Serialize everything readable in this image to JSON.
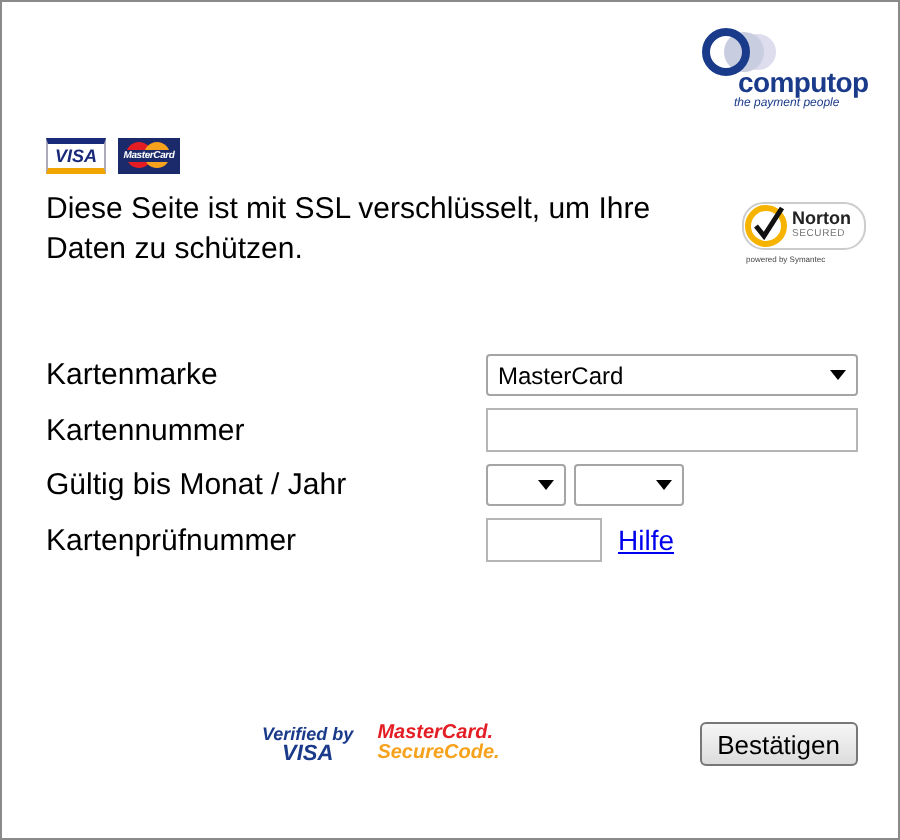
{
  "brand": {
    "name": "computop",
    "tagline": "the payment people"
  },
  "card_logos": [
    {
      "kind": "visa",
      "text": "VISA"
    },
    {
      "kind": "mastercard",
      "text": "MasterCard"
    }
  ],
  "notice": "Diese Seite ist mit SSL verschlüsselt, um Ihre Daten zu schützen.",
  "seal": {
    "name": "Norton",
    "status": "SECURED",
    "powered": "powered by Symantec"
  },
  "fields": [
    {
      "kind": "select",
      "label": "Kartenmarke",
      "value": "MasterCard"
    },
    {
      "kind": "text",
      "label": "Kartennummer"
    },
    {
      "kind": "date",
      "label": "Gültig bis Monat / Jahr"
    },
    {
      "kind": "cvc",
      "label": "Kartenprüfnummer",
      "link": "Hilfe"
    }
  ],
  "footer_logos": [
    {
      "kind": "visa",
      "lines": [
        "Verified by",
        "VISA"
      ]
    },
    {
      "kind": "mastercard",
      "lines": [
        "MasterCard.",
        "SecureCode."
      ]
    }
  ],
  "submit": "Bestätigen"
}
